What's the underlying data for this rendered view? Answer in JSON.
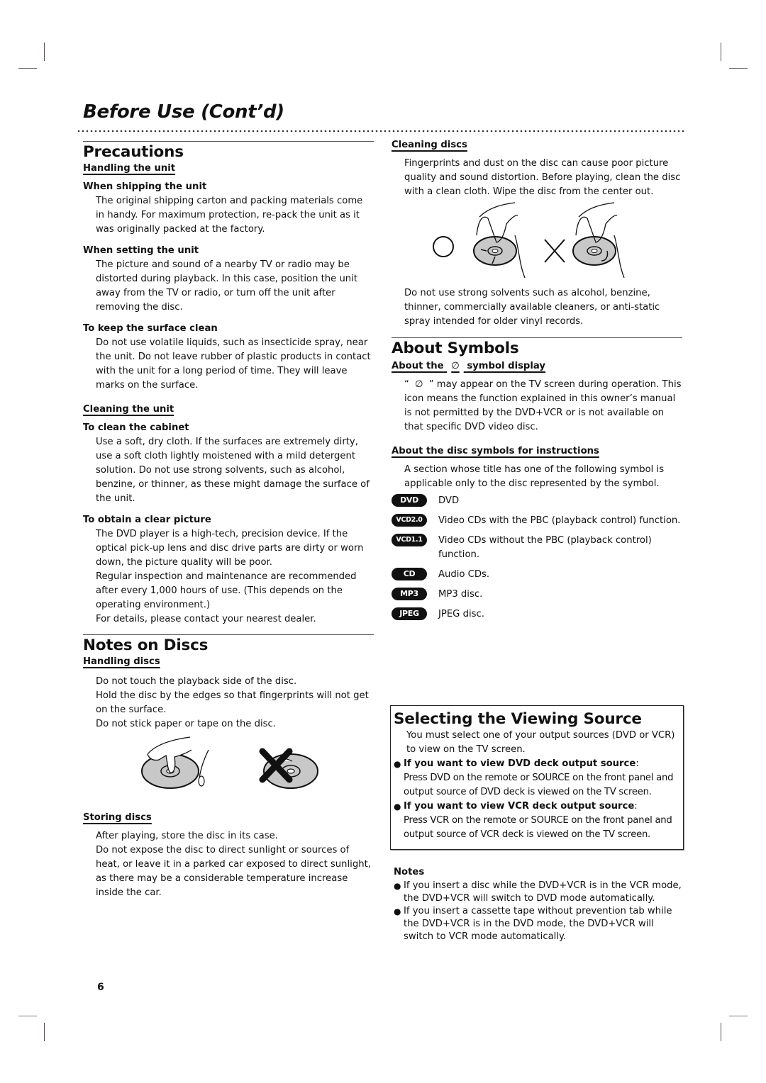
{
  "page": {
    "title": "Before Use (Cont’d)",
    "page_number": "6"
  },
  "precautions": {
    "heading": "Precautions",
    "handling_unit": {
      "heading": "Handling the unit",
      "shipping": {
        "heading": "When shipping the unit",
        "text": "The original shipping carton and packing materials come in handy. For maximum protection, re-pack the unit as it was originally packed at the factory."
      },
      "setting": {
        "heading": "When setting the unit",
        "text": "The picture and sound of a nearby TV or radio may be distorted during playback. In this case, position the unit away from the TV or radio, or turn off the unit after removing the disc."
      },
      "surface": {
        "heading": "To keep the surface clean",
        "text": "Do not use volatile liquids, such as insecticide spray, near the unit. Do not leave rubber of plastic products in contact with the unit for a long period of time. They will leave marks on the surface."
      }
    },
    "cleaning_unit": {
      "heading": "Cleaning the unit",
      "cabinet": {
        "heading": "To clean the cabinet",
        "text": "Use a soft, dry cloth. If the surfaces are extremely dirty, use a soft cloth lightly moistened with a mild detergent solution. Do not use strong solvents, such as alcohol, benzine, or thinner, as these might damage the surface of the unit."
      },
      "picture": {
        "heading": "To obtain a clear picture",
        "text1": "The DVD player is a high-tech, precision device. If the optical pick-up lens and disc drive parts are dirty or worn down, the picture quality will be poor.",
        "text2": "Regular inspection and maintenance are recommended after every 1,000 hours of use. (This depends on the operating environment.)",
        "text3": "For details, please contact your nearest dealer."
      }
    }
  },
  "notes_on_discs": {
    "heading": "Notes on Discs",
    "handling": {
      "heading": "Handling discs",
      "line1": "Do not touch the playback side of the disc.",
      "line2": "Hold the disc by the edges so that fingerprints will not get on the surface.",
      "line3": "Do not stick paper or tape on the disc."
    },
    "storing": {
      "heading": "Storing discs",
      "line1": "After playing, store the disc in its case.",
      "line2": "Do not expose the disc to direct sunlight or sources of heat, or leave it in a parked car exposed to direct sunlight, as there may be a considerable temperature increase inside the car."
    }
  },
  "cleaning_discs": {
    "heading": "Cleaning discs",
    "text": "Fingerprints and dust on the disc can cause poor picture quality and sound distortion. Before playing, clean the disc with a clean cloth. Wipe the disc from the center out.",
    "warning": "Do not use strong solvents such as alcohol, benzine, thinner, commercially available cleaners, or anti-static spray intended for older vinyl records."
  },
  "about_symbols": {
    "heading": "About Symbols",
    "symbol_display": {
      "heading_pre": "About the",
      "heading_post": "symbol display",
      "quote_open": "“",
      "quote_close": "”",
      "text_after": "may appear on the TV screen during operation. This icon means the function explained in this owner’s manual is not permitted by the DVD+VCR or is not available on that specific DVD video disc.",
      "icon": "∅"
    },
    "disc_symbols": {
      "heading": "About the disc symbols for instructions",
      "text": "A section whose title has one of the following symbol is applicable only to the disc represented by the symbol.",
      "items": [
        {
          "badge": "DVD",
          "label": "DVD"
        },
        {
          "badge": "VCD2.0",
          "label": "Video CDs with the PBC (playback control) function."
        },
        {
          "badge": "VCD1.1",
          "label": "Video CDs without the PBC (playback control) function."
        },
        {
          "badge": "CD",
          "label": "Audio CDs."
        },
        {
          "badge": "MP3",
          "label": "MP3 disc."
        },
        {
          "badge": "JPEG",
          "label": "JPEG disc."
        }
      ]
    }
  },
  "viewing_source": {
    "heading": "Selecting the Viewing Source",
    "intro": "You must select one of your output sources (DVD or VCR) to view on the TV screen.",
    "bullets": [
      {
        "bold": "If you want to view DVD deck output source",
        "colon": ":",
        "text": "Press DVD on the remote or SOURCE on the front panel and output source of DVD deck is viewed on the TV screen."
      },
      {
        "bold": "If you want to view VCR deck output source",
        "colon": ":",
        "text": "Press VCR on the remote or SOURCE on the front panel and output source of VCR deck is viewed on the TV screen."
      }
    ],
    "bullet_glyph": "●"
  },
  "notes": {
    "heading": "Notes",
    "items": [
      "If you insert a disc while the DVD+VCR is in the VCR mode, the DVD+VCR will switch to DVD mode automatically.",
      "If you insert a cassette tape without prevention tab while the DVD+VCR is in the DVD mode, the DVD+VCR will switch to VCR mode automatically."
    ]
  }
}
